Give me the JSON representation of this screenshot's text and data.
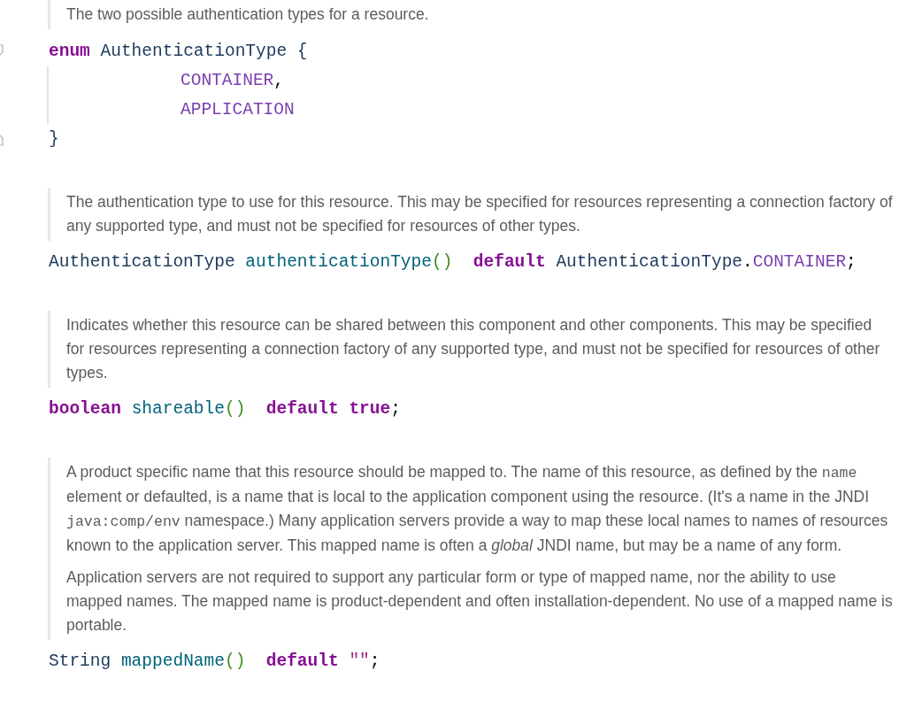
{
  "blocks": [
    {
      "kind": "doc",
      "paragraphs": [
        [
          {
            "kind": "text",
            "text": "The two possible authentication types for a resource."
          }
        ]
      ]
    },
    {
      "kind": "code",
      "lines": [
        {
          "kind": "fold-start",
          "tokens": [
            {
              "kind": "keyword",
              "text": "enum"
            },
            {
              "kind": "type",
              "text": "AuthenticationType"
            },
            {
              "kind": "type",
              "text": "{"
            }
          ]
        },
        {
          "kind": "member",
          "tokens": [
            {
              "kind": "constant",
              "text": "CONTAINER"
            },
            {
              "kind": "punct",
              "text": ","
            }
          ]
        },
        {
          "kind": "member",
          "tokens": [
            {
              "kind": "constant",
              "text": "APPLICATION"
            }
          ]
        },
        {
          "kind": "fold-end",
          "tokens": [
            {
              "kind": "type",
              "text": "}"
            }
          ]
        }
      ]
    },
    {
      "kind": "doc",
      "paragraphs": [
        [
          {
            "kind": "text",
            "text": "The authentication type to use for this resource. This may be specified for resources representing a connection factory of any supported type, and must not be specified for resources of other types."
          }
        ]
      ]
    },
    {
      "kind": "code",
      "lines": [
        {
          "kind": "plain",
          "tokens": [
            {
              "kind": "type",
              "text": "AuthenticationType"
            },
            {
              "kind": "method",
              "text": "authenticationType"
            },
            {
              "kind": "paren",
              "text": "()"
            },
            {
              "kind": "keyword",
              "text": "default"
            },
            {
              "kind": "type",
              "text": "AuthenticationType"
            },
            {
              "kind": "punct",
              "text": "."
            },
            {
              "kind": "constant",
              "text": "CONTAINER"
            },
            {
              "kind": "punct",
              "text": ";"
            }
          ]
        }
      ]
    },
    {
      "kind": "doc",
      "paragraphs": [
        [
          {
            "kind": "text",
            "text": "Indicates whether this resource can be shared between this component and other components. This may be specified for resources representing a connection factory of any supported type, and must not be specified for resources of other types."
          }
        ]
      ]
    },
    {
      "kind": "code",
      "lines": [
        {
          "kind": "plain",
          "tokens": [
            {
              "kind": "keyword",
              "text": "boolean"
            },
            {
              "kind": "method",
              "text": "shareable"
            },
            {
              "kind": "paren",
              "text": "()"
            },
            {
              "kind": "keyword",
              "text": "default"
            },
            {
              "kind": "keyword",
              "text": "true"
            },
            {
              "kind": "punct",
              "text": ";"
            }
          ]
        }
      ]
    },
    {
      "kind": "doc",
      "paragraphs": [
        [
          {
            "kind": "text",
            "text": "A product specific name that this resource should be mapped to. The name of this resource, as defined by the "
          },
          {
            "kind": "code",
            "text": "name"
          },
          {
            "kind": "text",
            "text": " element or defaulted, is a name that is local to the application component using the resource. (It's a name in the JNDI "
          },
          {
            "kind": "code",
            "text": "java:comp/env"
          },
          {
            "kind": "text",
            "text": " namespace.) Many application servers provide a way to map these local names to names of resources known to the application server. This mapped name is often a "
          },
          {
            "kind": "italic",
            "text": "global"
          },
          {
            "kind": "text",
            "text": " JNDI name, but may be a name of any form."
          }
        ],
        [
          {
            "kind": "text",
            "text": "Application servers are not required to support any particular form or type of mapped name, nor the ability to use mapped names. The mapped name is product-dependent and often installation-dependent. No use of a mapped name is portable."
          }
        ]
      ]
    },
    {
      "kind": "code",
      "lines": [
        {
          "kind": "plain",
          "tokens": [
            {
              "kind": "type",
              "text": "String"
            },
            {
              "kind": "method",
              "text": "mappedName"
            },
            {
              "kind": "paren",
              "text": "()"
            },
            {
              "kind": "keyword",
              "text": "default"
            },
            {
              "kind": "string",
              "text": "\"\""
            },
            {
              "kind": "punct",
              "text": ";"
            }
          ]
        }
      ]
    }
  ]
}
